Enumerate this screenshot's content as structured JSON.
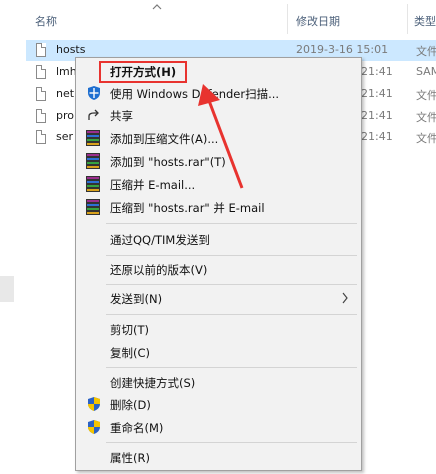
{
  "explorer": {
    "columns": {
      "name": "名称",
      "modified": "修改日期",
      "type": "类型"
    },
    "files": [
      {
        "name": "hosts",
        "date": "2019-3-16 15:01",
        "type": "文件",
        "selected": true
      },
      {
        "name": "lmh",
        "date": "21:41",
        "type": "SAM"
      },
      {
        "name": "net",
        "date": "21:41",
        "type": "文件"
      },
      {
        "name": "pro",
        "date": "21:41",
        "type": "文件"
      },
      {
        "name": "ser",
        "date": "21:41",
        "type": "文件"
      }
    ]
  },
  "context_menu": {
    "open_with": "打开方式(H)",
    "defender_scan": "使用 Windows Defender扫描...",
    "share": "共享",
    "add_to_archive": "添加到压缩文件(A)...",
    "add_to_rar": "添加到 \"hosts.rar\"(T)",
    "compress_email": "压缩并 E-mail...",
    "compress_rar_email": "压缩到 \"hosts.rar\" 并 E-mail",
    "send_qq_tim": "通过QQ/TIM发送到",
    "restore_previous": "还原以前的版本(V)",
    "send_to": "发送到(N)",
    "cut": "剪切(T)",
    "copy": "复制(C)",
    "create_shortcut": "创建快捷方式(S)",
    "delete": "删除(D)",
    "rename": "重命名(M)",
    "properties": "属性(R)"
  },
  "annotation": {
    "highlight_color": "#e8332f"
  }
}
